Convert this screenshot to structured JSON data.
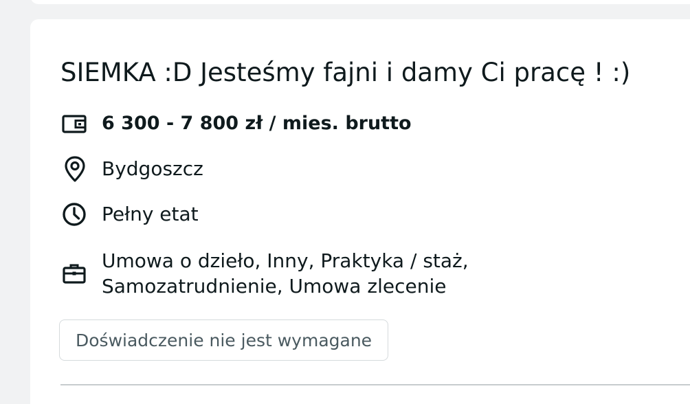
{
  "job": {
    "title": "SIEMKA :D Jesteśmy fajni i damy Ci pracę ! :)",
    "salary": {
      "icon": "wallet-icon",
      "text": "6 300 - 7 800 zł / mies. brutto"
    },
    "location": {
      "icon": "location-pin-icon",
      "text": "Bydgoszcz"
    },
    "work_time": {
      "icon": "clock-icon",
      "text": "Pełny etat"
    },
    "contract": {
      "icon": "briefcase-icon",
      "line1": "Umowa o dzieło, Inny, Praktyka / staż,",
      "line2": "Samozatrudnienie, Umowa zlecenie"
    },
    "experience_tag": "Doświadczenie nie jest wymagane"
  },
  "colors": {
    "background": "#f1f2f3",
    "card": "#ffffff",
    "text": "#0f1a1d",
    "tag_text": "#4a5a60",
    "tag_border": "#d5dadc"
  }
}
